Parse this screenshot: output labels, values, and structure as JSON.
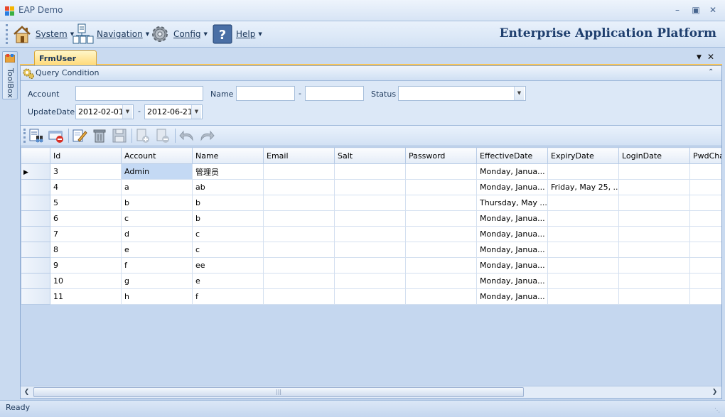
{
  "window": {
    "title": "EAP Demo"
  },
  "menu": [
    {
      "label": "System",
      "icon": "home-icon"
    },
    {
      "label": "Navigation",
      "icon": "navigation-icon"
    },
    {
      "label": "Config",
      "icon": "gear-icon"
    },
    {
      "label": "Help",
      "icon": "help-icon"
    }
  ],
  "brand": "Enterprise Application Platform",
  "toolbox": {
    "label": "ToolBox"
  },
  "tab": {
    "label": "FrmUser"
  },
  "query": {
    "title": "Query Condition",
    "account_label": "Account",
    "account_value": "",
    "name_label": "Name",
    "name_from": "",
    "name_dash": "-",
    "name_to": "",
    "status_label": "Status",
    "status_value": "",
    "updatedate_label": "UpdateDate",
    "date_from": "2012-02-01",
    "date_dash": "-",
    "date_to": "2012-06-21"
  },
  "toolbar": [
    "query-icon",
    "delete-icon",
    "edit-icon",
    "clear-icon",
    "save-icon",
    "add-row-icon",
    "remove-row-icon",
    "undo-icon",
    "redo-icon"
  ],
  "grid": {
    "columns": [
      "Id",
      "Account",
      "Name",
      "Email",
      "Salt",
      "Password",
      "EffectiveDate",
      "ExpiryDate",
      "LoginDate",
      "PwdCha"
    ],
    "rows": [
      [
        "3",
        "Admin",
        "管理员",
        "",
        "",
        "",
        "Monday, Janua...",
        "",
        "",
        ""
      ],
      [
        "4",
        "a",
        "ab",
        "",
        "",
        "",
        "Monday, Janua...",
        "Friday, May 25, ...",
        "",
        ""
      ],
      [
        "5",
        "b",
        "b",
        "",
        "",
        "",
        "Thursday, May ...",
        "",
        "",
        ""
      ],
      [
        "6",
        "c",
        "b",
        "",
        "",
        "",
        "Monday, Janua...",
        "",
        "",
        ""
      ],
      [
        "7",
        "d",
        "c",
        "",
        "",
        "",
        "Monday, Janua...",
        "",
        "",
        ""
      ],
      [
        "8",
        "e",
        "c",
        "",
        "",
        "",
        "Monday, Janua...",
        "",
        "",
        ""
      ],
      [
        "9",
        "f",
        "ee",
        "",
        "",
        "",
        "Monday, Janua...",
        "",
        "",
        ""
      ],
      [
        "10",
        "g",
        "e",
        "",
        "",
        "",
        "Monday, Janua...",
        "",
        "",
        ""
      ],
      [
        "11",
        "h",
        "f",
        "",
        "",
        "",
        "Monday, Janua...",
        "",
        "",
        ""
      ]
    ],
    "current_row_marker": "▶"
  },
  "status": {
    "text": "Ready"
  },
  "colors": {
    "accent": "#1f3f6e",
    "tab": "#ffd874",
    "selection": "#c4d9f4"
  }
}
